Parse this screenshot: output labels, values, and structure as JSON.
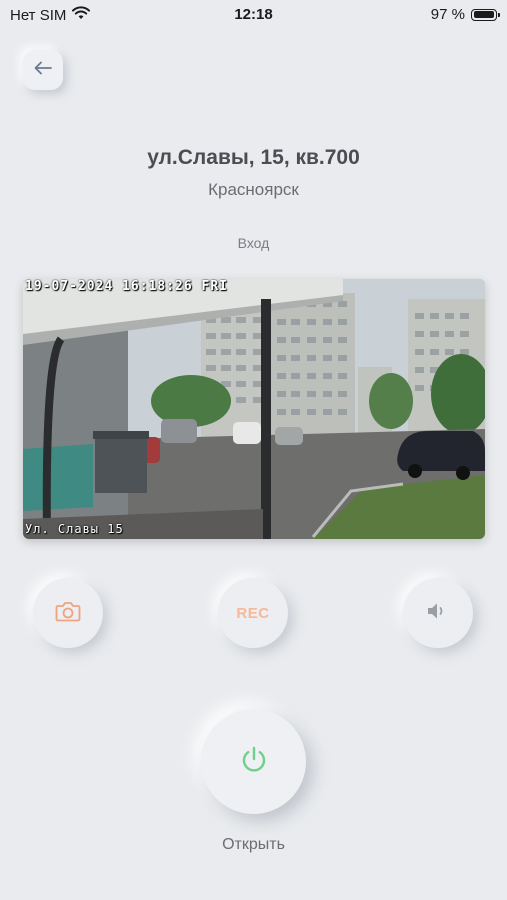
{
  "status_bar": {
    "carrier": "Нет SIM",
    "time": "12:18",
    "battery_percent_label": "97 %",
    "battery_level": 0.97
  },
  "header": {
    "back_icon": "arrow-left-icon",
    "address": "ул.Славы, 15, кв.700",
    "city": "Красноярск",
    "camera_name": "Вход"
  },
  "video": {
    "overlay_timestamp": "19-07-2024 16:18:26 FRI",
    "overlay_location": "Ул. Славы 15"
  },
  "controls": {
    "snapshot_icon": "camera-icon",
    "record_label": "REC",
    "sound_icon": "speaker-icon",
    "open_icon": "power-icon",
    "open_label": "Открыть"
  },
  "colors": {
    "background": "#e9ebee",
    "accent_orange": "#f7b89a",
    "accent_green": "#6fd08a",
    "muted_icon": "#9a9ea5"
  }
}
